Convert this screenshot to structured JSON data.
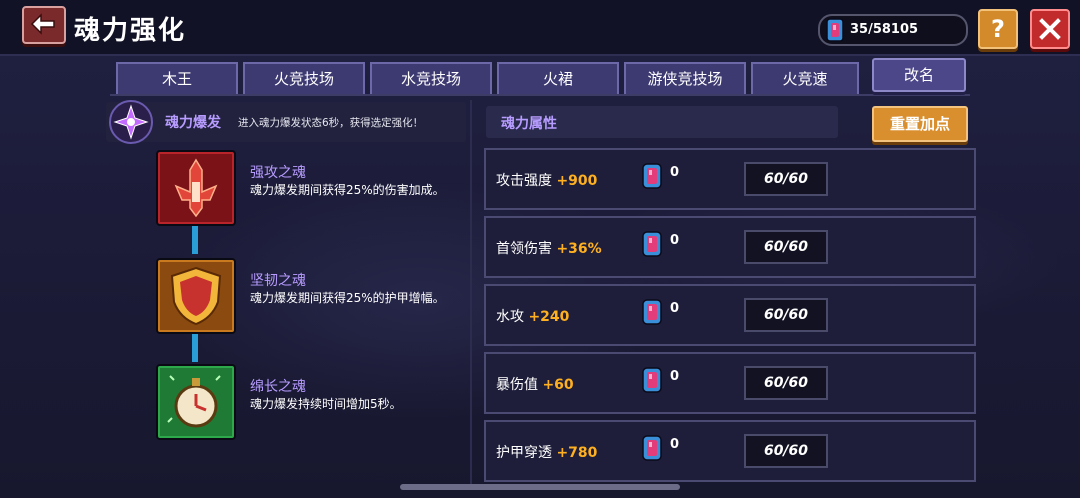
{
  "header": {
    "title": "魂力强化",
    "currency_amount": "35/58105",
    "help_label": "?"
  },
  "tabs": [
    {
      "label": "木王"
    },
    {
      "label": "火竞技场"
    },
    {
      "label": "水竞技场"
    },
    {
      "label": "火裙"
    },
    {
      "label": "游侠竞技场"
    },
    {
      "label": "火竞速"
    }
  ],
  "rename_label": "改名",
  "burst": {
    "title": "魂力爆发",
    "description": "进入魂力爆发状态6秒，获得选定强化！"
  },
  "skills": [
    {
      "name": "强攻之魂",
      "desc": "魂力爆发期间获得25%的伤害加成。",
      "icon": "sword-icon",
      "color": "#b8242a"
    },
    {
      "name": "坚韧之魂",
      "desc": "魂力爆发期间获得25%的护甲增幅。",
      "icon": "shield-icon",
      "color": "#c97a1e"
    },
    {
      "name": "绵长之魂",
      "desc": "魂力爆发持续时间增加5秒。",
      "icon": "stopwatch-icon",
      "color": "#2da84a"
    }
  ],
  "attributes_title": "魂力属性",
  "reset_label": "重置加点",
  "attributes": [
    {
      "label": "攻击强度",
      "bonus": "+900",
      "points": "0",
      "cap": "60/60"
    },
    {
      "label": "首领伤害",
      "bonus": "+36%",
      "points": "0",
      "cap": "60/60"
    },
    {
      "label": "水攻",
      "bonus": "+240",
      "points": "0",
      "cap": "60/60"
    },
    {
      "label": "暴伤值",
      "bonus": "+60",
      "points": "0",
      "cap": "60/60"
    },
    {
      "label": "护甲穿透",
      "bonus": "+780",
      "points": "0",
      "cap": "60/60"
    }
  ],
  "colors": {
    "accent_orange": "#ffb020",
    "title_purple": "#b79cff",
    "close_red": "#c22b2b"
  }
}
